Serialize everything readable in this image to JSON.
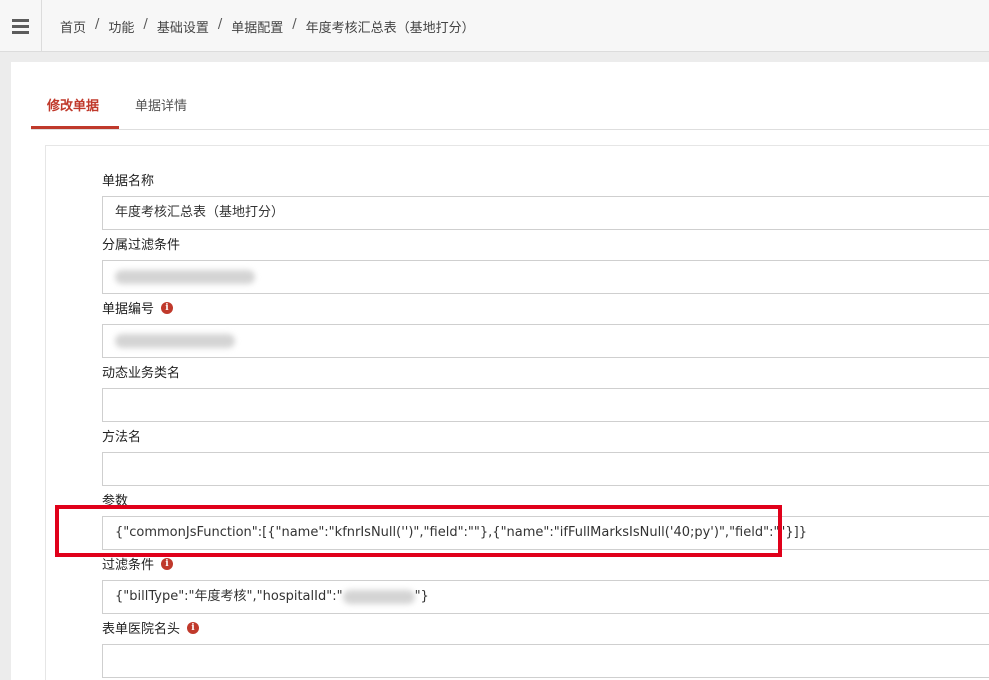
{
  "breadcrumb": {
    "items": [
      "首页",
      "功能",
      "基础设置",
      "单据配置",
      "年度考核汇总表（基地打分）"
    ],
    "separator": "/"
  },
  "tabs": [
    {
      "label": "修改单据",
      "active": true
    },
    {
      "label": "单据详情",
      "active": false
    }
  ],
  "form": {
    "bill_name": {
      "label": "单据名称",
      "value": "年度考核汇总表（基地打分）"
    },
    "filter_condition": {
      "label": "分属过滤条件",
      "value": ""
    },
    "bill_number": {
      "label": "单据编号",
      "value": ""
    },
    "dynamic_class": {
      "label": "动态业务类名",
      "value": ""
    },
    "method_name": {
      "label": "方法名",
      "value": ""
    },
    "params": {
      "label": "参数",
      "value": "{\"commonJsFunction\":[{\"name\":\"kfnrIsNull('')\",\"field\":\"\"},{\"name\":\"ifFullMarksIsNull('40;py')\",\"field\":\"\"}]}"
    },
    "filter": {
      "label": "过滤条件",
      "value_prefix": "{\"billType\":\"年度考核\",\"hospitalId\":\"",
      "value_suffix": "\"}"
    },
    "hospital_header": {
      "label": "表单医院名头",
      "value": ""
    }
  },
  "colors": {
    "accent": "#c0392b",
    "highlight": "#e0001a"
  },
  "icons": {
    "menu": "hamburger-icon",
    "info": "info-icon"
  }
}
